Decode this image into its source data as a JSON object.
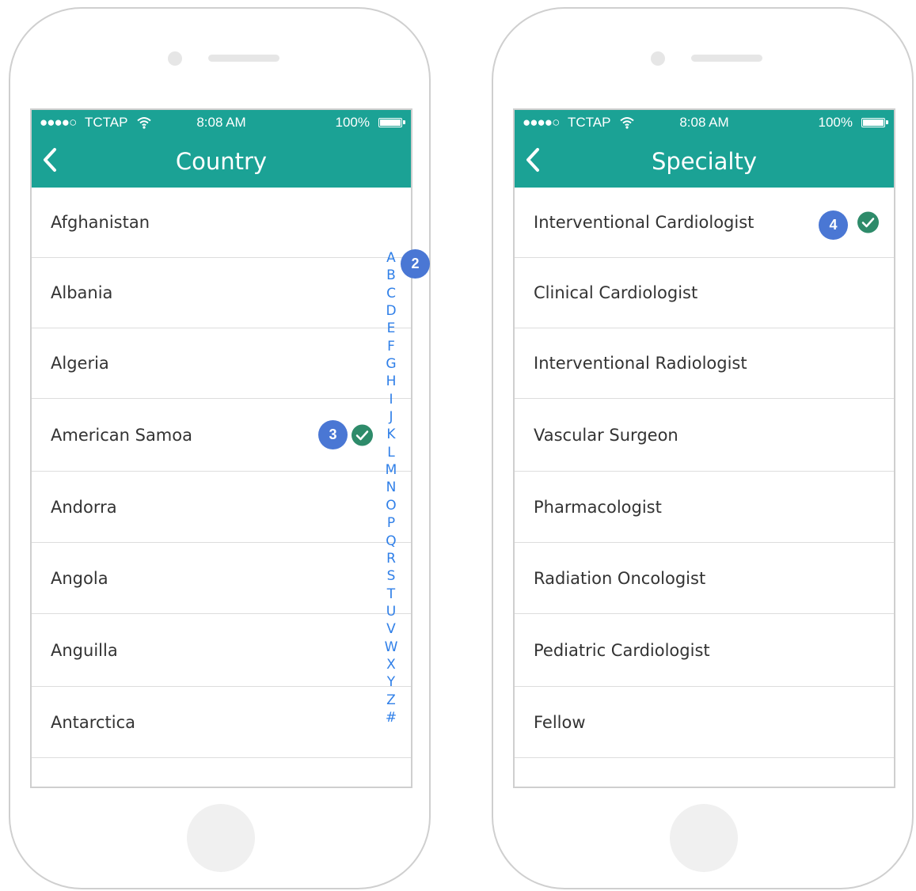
{
  "left_screen": {
    "status": {
      "signal": "●●●●○",
      "carrier": "TCTAP",
      "time": "8:08 AM",
      "battery": "100%"
    },
    "title": "Country",
    "items": [
      "Afghanistan",
      "Albania",
      "Algeria",
      "American Samoa",
      "Andorra",
      "Angola",
      "Anguilla",
      "Antarctica"
    ],
    "selected_item": "American Samoa",
    "index_letters": [
      "A",
      "B",
      "C",
      "D",
      "E",
      "F",
      "G",
      "H",
      "I",
      "J",
      "K",
      "L",
      "M",
      "N",
      "O",
      "P",
      "Q",
      "R",
      "S",
      "T",
      "U",
      "V",
      "W",
      "X",
      "Y",
      "Z",
      "#"
    ],
    "annotation_index": "2",
    "annotation_selected": "3"
  },
  "right_screen": {
    "status": {
      "signal": "●●●●○",
      "carrier": "TCTAP",
      "time": "8:08 AM",
      "battery": "100%"
    },
    "title": "Specialty",
    "items": [
      "Interventional Cardiologist",
      "Clinical Cardiologist",
      "Interventional Radiologist",
      "Vascular Surgeon",
      "Pharmacologist",
      "Radiation Oncologist",
      "Pediatric Cardiologist",
      "Fellow"
    ],
    "selected_item": "Interventional Cardiologist",
    "annotation_selected": "4"
  },
  "colors": {
    "header": "#1ba295",
    "check": "#2e8b6a",
    "badge": "#4a77d4",
    "index": "#2f7fe8"
  },
  "icons": [
    "back-chevron-icon",
    "wifi-icon",
    "battery-icon",
    "checkmark-icon"
  ]
}
